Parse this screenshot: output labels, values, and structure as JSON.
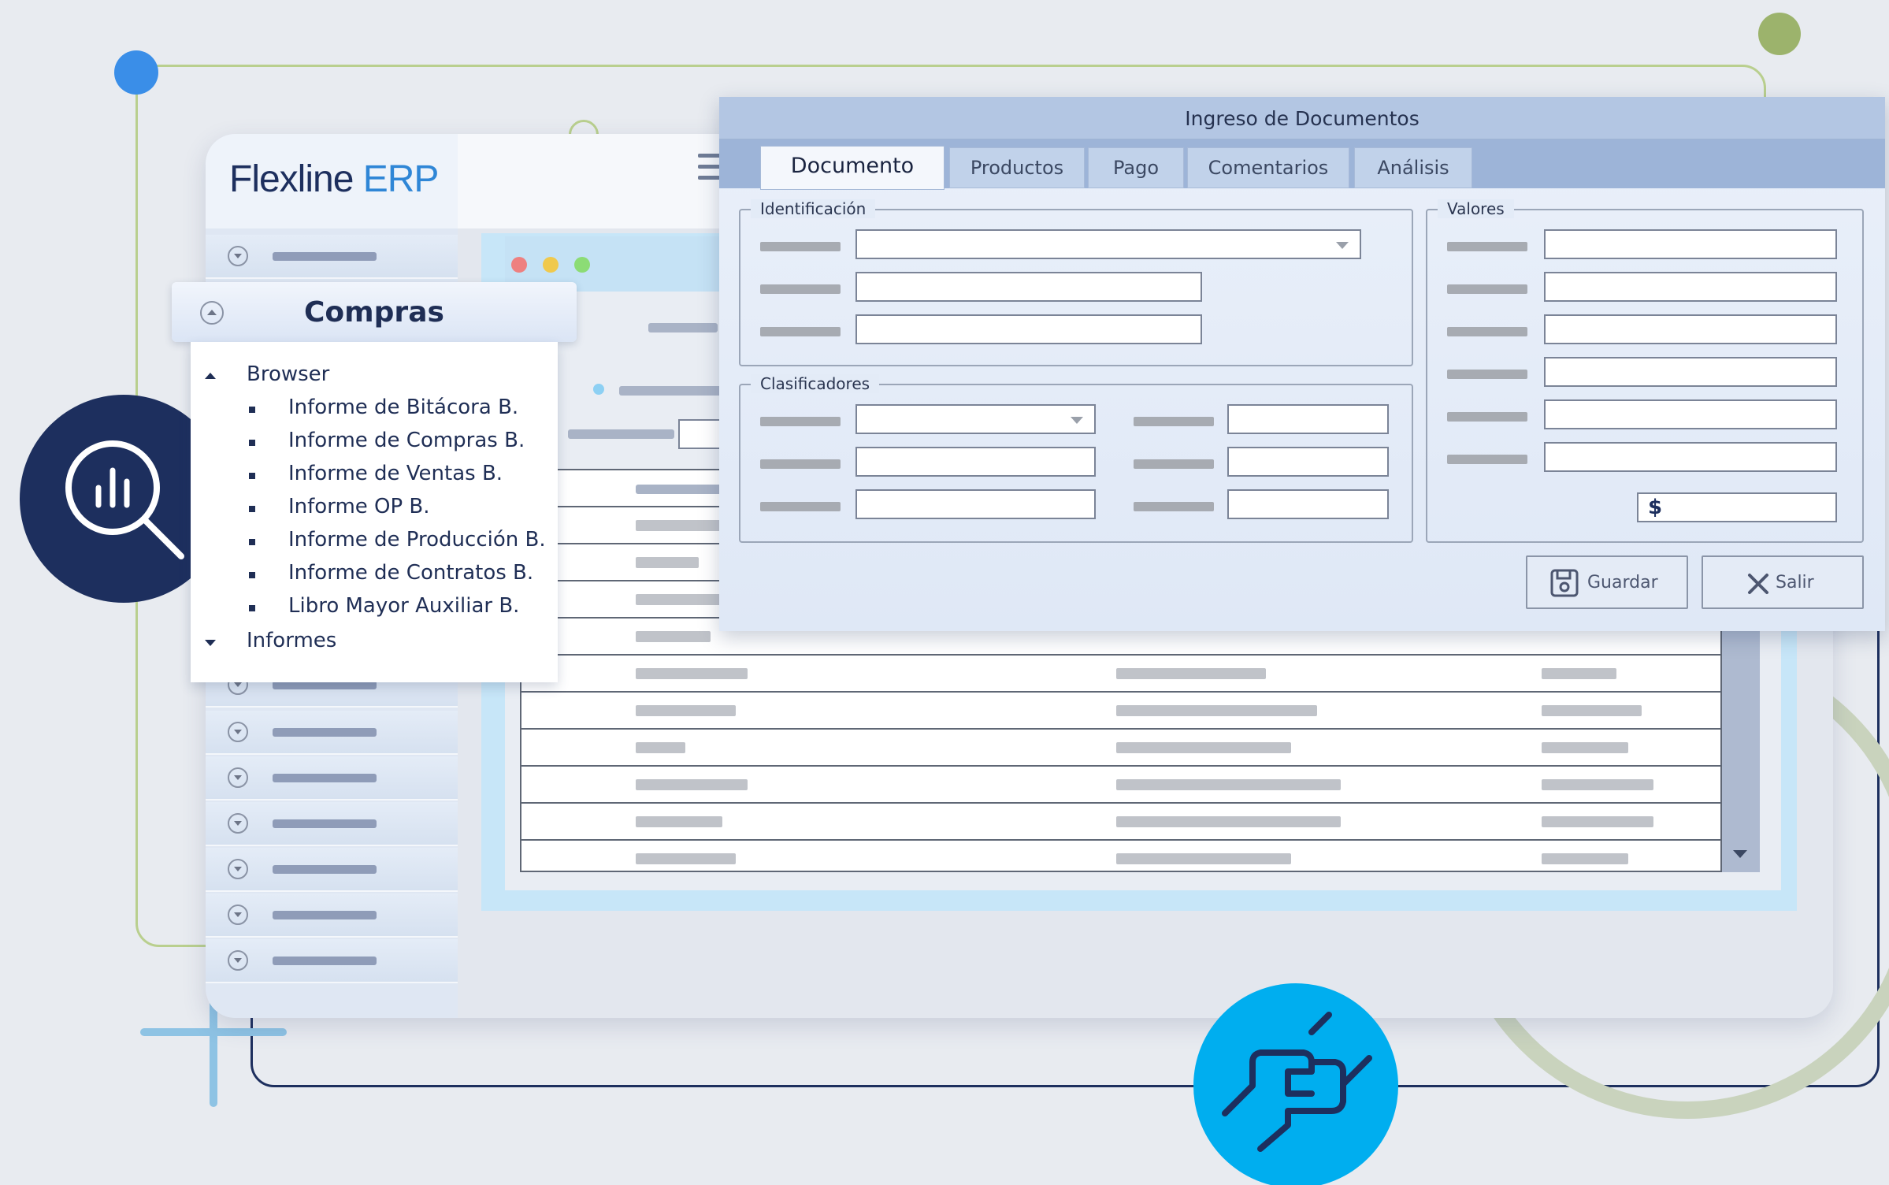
{
  "app": {
    "brand_main": "Flexline",
    "brand_accent": "ERP"
  },
  "compras": {
    "title": "Compras",
    "browser_label": "Browser",
    "items": [
      "Informe de Bitácora B.",
      "Informe de Compras B.",
      "Informe de Ventas B.",
      "Informe OP B.",
      "Informe de Producción B.",
      "Informe de Contratos B.",
      "Libro Mayor Auxiliar B."
    ],
    "informes_label": "Informes"
  },
  "dialog": {
    "title": "Ingreso de Documentos",
    "tabs": [
      "Documento",
      "Productos",
      "Pago",
      "Comentarios",
      "Análisis"
    ],
    "active_tab": "Documento",
    "group_identificacion": "Identificación",
    "group_clasificadores": "Clasificadores",
    "group_valores": "Valores",
    "currency_symbol": "$",
    "save_label": "Guardar",
    "exit_label": "Salir"
  },
  "colors": {
    "brand_navy": "#1d2f5e",
    "brand_blue": "#3a8ee8",
    "accent_cyan": "#00aeef",
    "accent_green": "#9cb36c"
  },
  "icons": [
    "search-analytics-icon",
    "handshake-icon",
    "hamburger-menu-icon",
    "save-icon",
    "close-icon"
  ]
}
